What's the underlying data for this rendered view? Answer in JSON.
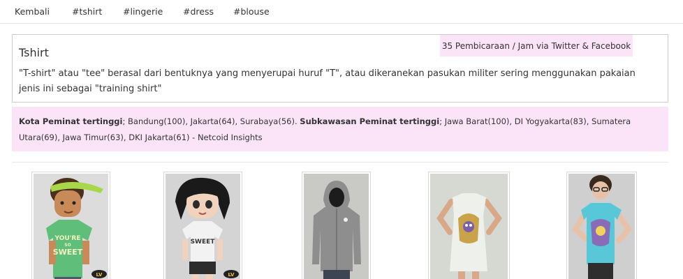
{
  "nav": {
    "items": [
      {
        "label": "Kembali"
      },
      {
        "label": "#tshirt"
      },
      {
        "label": "#lingerie"
      },
      {
        "label": "#dress"
      },
      {
        "label": "#blouse"
      }
    ]
  },
  "topic": {
    "title": "Tshirt",
    "badge": "35 Pembicaraan / Jam via Twitter & Facebook",
    "description": "\"T-shirt\" atau \"tee\" berasal dari bentuknya yang menyerupai huruf \"T\", atau dikeranekan pasukan militer sering menggunakan pakaian jenis ini sebagai \"training shirt\""
  },
  "insights": {
    "city_label": "Kota Peminat tertinggi",
    "city_values": "; Bandung(100), Jakarta(64), Surabaya(56). ",
    "region_label": "Subkawasan Peminat tertinggi",
    "region_values": "; Jawa Barat(100), DI Yogyakarta(83), Sumatera Utara(69), Jawa Timur(63), DKI Jakarta(61) - Netcoid Insights"
  },
  "products": [
    {
      "shirt_text": "YOU'RE SO SWEET",
      "logo_text": "LV",
      "colors": {
        "bg": "#dcdcdc",
        "shirt": "#5fbf7a",
        "skin": "#c98a5a",
        "hair": "#4a2f1c",
        "visor": "#a8d84a"
      }
    },
    {
      "shirt_text": "SWEET",
      "logo_text": "LV",
      "colors": {
        "bg": "#d4d4d4",
        "shirt": "#f2f2f2",
        "skin": "#f1d2bc",
        "hair": "#1a1a1a",
        "shorts": "#2d2d2d"
      }
    },
    {
      "colors": {
        "bg": "#c9c9c6",
        "hoodie": "#8e8e8e",
        "jeans": "#3d4555"
      }
    },
    {
      "colors": {
        "bg": "#d6d9d2",
        "dress": "#eef0ec",
        "skin": "#d9a888",
        "print": "#c9a24a"
      }
    },
    {
      "colors": {
        "bg": "#cfcfcf",
        "shirt": "#58c8d8",
        "skin": "#e8c2a8",
        "hair": "#3a2a1e",
        "pants": "#2e2e2e"
      }
    }
  ]
}
